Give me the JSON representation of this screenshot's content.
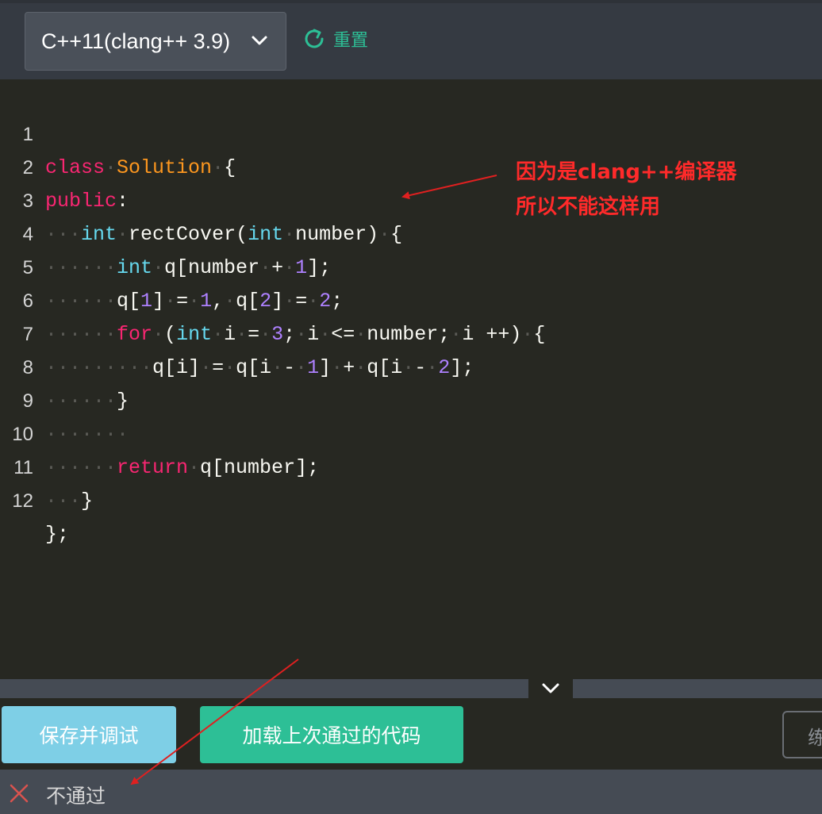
{
  "toolbar": {
    "language": "C++11(clang++ 3.9)",
    "reset_label": "重置"
  },
  "editor": {
    "lines": [
      {
        "n": "1"
      },
      {
        "n": "2"
      },
      {
        "n": "3"
      },
      {
        "n": "4"
      },
      {
        "n": "5"
      },
      {
        "n": "6"
      },
      {
        "n": "7"
      },
      {
        "n": "8"
      },
      {
        "n": "9"
      },
      {
        "n": "10"
      },
      {
        "n": "11"
      },
      {
        "n": "12"
      }
    ],
    "tokens": {
      "class": "class",
      "Solution": "Solution",
      "brace_open": "{",
      "public": "public",
      "colon": ":",
      "int": "int",
      "rectCover": "rectCover(",
      "number_param": "number)",
      "q_decl": "q[number",
      "plus": "+",
      "one": "1",
      "close_semi": "];",
      "q1": "q[",
      "idx1": "1",
      "q1_close": "]",
      "eq": "=",
      "val1": "1",
      "comma": ",",
      "q2": "q[",
      "idx2": "2",
      "q2_close": "]",
      "val2": "2",
      "semi": ";",
      "for": "for",
      "paren_open": "(",
      "i": "i",
      "three": "3",
      "le": "<=",
      "number": "number;",
      "inc": "i ++)",
      "qi": "q[i]",
      "qi1": "q[i",
      "minus": "-",
      "qi2": "q[i",
      "two": "2",
      "end": "];",
      "close_brace": "}",
      "return": "return",
      "q_number": "q[number];",
      "final": "};"
    }
  },
  "annotation": {
    "line1": "因为是clang++编译器",
    "line2": "所以不能这样用"
  },
  "actions": {
    "save_debug": "保存并调试",
    "load_last": "加载上次通过的代码",
    "partial": "练"
  },
  "status": {
    "text": "不通过"
  },
  "colors": {
    "accent": "#2dbf96",
    "annotation": "#ff2a2a",
    "keyword": "#f92672",
    "type": "#66d9ef",
    "class_name": "#fd971f",
    "number": "#ae81ff"
  },
  "icons": {
    "chevron": "chevron-down-icon",
    "reset": "refresh-icon",
    "status": "close-icon"
  }
}
